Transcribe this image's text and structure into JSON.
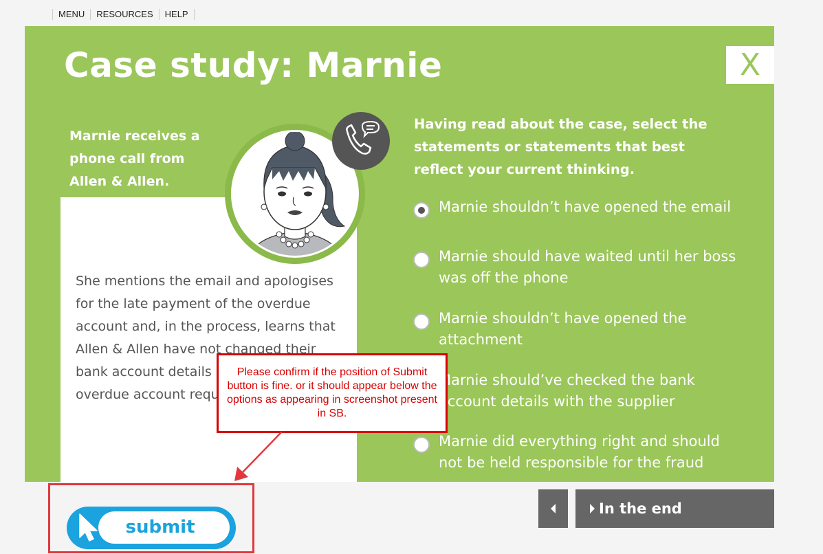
{
  "nav": {
    "items": [
      "MENU",
      "RESOURCES",
      "HELP"
    ]
  },
  "panel": {
    "title": "Case study: Marnie",
    "close_label": "X",
    "intro": "Marnie receives a phone call from Allen & Allen.",
    "story": "She mentions the email and apologises for the late payment of the overdue account and, in the process, learns that Allen & Allen have not changed their bank account details and never had an overdue account requiring payment."
  },
  "question": {
    "prompt": "Having read about the case, select the statements or statements that best reflect your current thinking.",
    "options": [
      {
        "label": "Marnie shouldn’t have opened the email",
        "selected": true
      },
      {
        "label": "Marnie should have waited until her boss was off the phone",
        "selected": false
      },
      {
        "label": "Marnie shouldn’t have opened the attachment",
        "selected": false
      },
      {
        "label": "Marnie should’ve checked the bank account details with the supplier",
        "selected": false
      },
      {
        "label": "Marnie did everything right and should not be held responsible for the fraud",
        "selected": false
      }
    ]
  },
  "callout": {
    "text": "Please confirm if the position of Submit button is fine. or it should appear below the options as appearing in screenshot present in SB."
  },
  "footer": {
    "submit_label": "submit",
    "next_label": "In the end"
  },
  "colors": {
    "panel_green": "#9bc65a",
    "submit_blue": "#1aa3de",
    "callout_red": "#d80000",
    "nav_button_gray": "#666666"
  },
  "icons": [
    "phone-chat-icon",
    "close-icon",
    "cursor-icon",
    "chevron-left-icon",
    "chevron-right-icon"
  ]
}
